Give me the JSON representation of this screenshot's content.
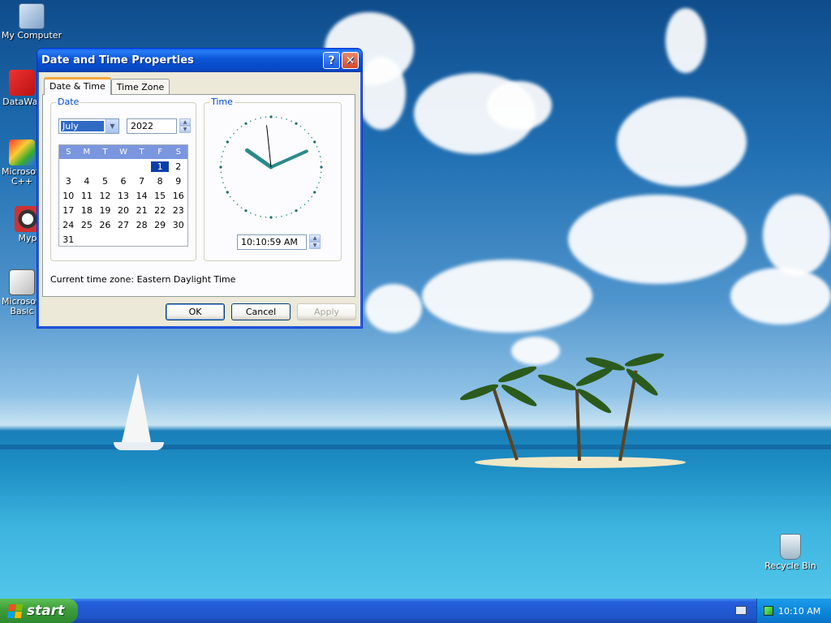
{
  "desktop": {
    "icons": [
      {
        "label": "My Computer"
      },
      {
        "label": "DataWar"
      },
      {
        "label": "Microsoft C++"
      },
      {
        "label": "Myp"
      },
      {
        "label": "Microsoft Basic"
      },
      {
        "label": "Recycle Bin"
      }
    ]
  },
  "dialog": {
    "title": "Date and Time Properties",
    "help_glyph": "?",
    "close_glyph": "✕",
    "tabs": [
      {
        "label": "Date & Time",
        "active": true
      },
      {
        "label": "Time Zone",
        "active": false
      }
    ],
    "date_group": {
      "title": "Date",
      "month": "July",
      "year": "2022",
      "weekdays": [
        "S",
        "M",
        "T",
        "W",
        "T",
        "F",
        "S"
      ],
      "weeks": [
        [
          "",
          "",
          "",
          "",
          "",
          "1",
          "2"
        ],
        [
          "3",
          "4",
          "5",
          "6",
          "7",
          "8",
          "9"
        ],
        [
          "10",
          "11",
          "12",
          "13",
          "14",
          "15",
          "16"
        ],
        [
          "17",
          "18",
          "19",
          "20",
          "21",
          "22",
          "23"
        ],
        [
          "24",
          "25",
          "26",
          "27",
          "28",
          "29",
          "30"
        ],
        [
          "31",
          "",
          "",
          "",
          "",
          "",
          ""
        ]
      ],
      "selected_day": "1"
    },
    "time_group": {
      "title": "Time",
      "time_value": "10:10:59 AM",
      "clock": {
        "hour": 10,
        "minute": 10,
        "second": 59
      }
    },
    "timezone_label": "Current time zone:",
    "timezone_value": "Eastern Daylight Time",
    "buttons": {
      "ok": "OK",
      "cancel": "Cancel",
      "apply": "Apply"
    }
  },
  "taskbar": {
    "start_label": "start",
    "clock": "10:10 AM"
  },
  "colors": {
    "title_blue": "#0a54d6",
    "tab_highlight": "#f5a73c",
    "group_title": "#0046d5",
    "clock_hands": "#2a8a8a"
  }
}
